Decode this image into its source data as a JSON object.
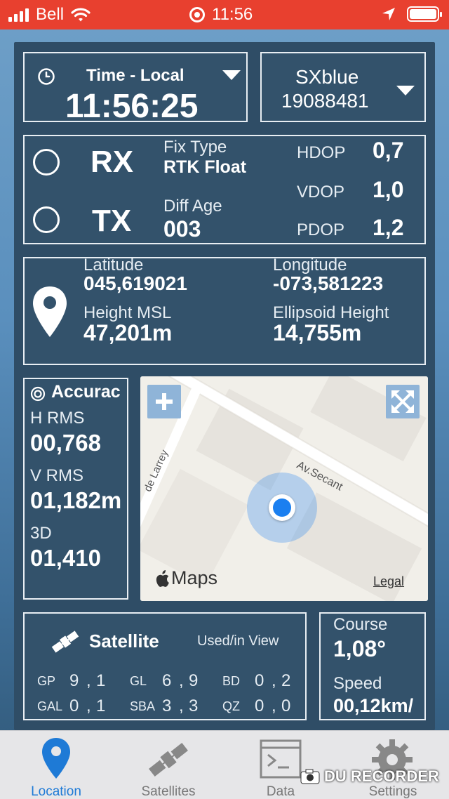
{
  "status_bar": {
    "carrier": "Bell",
    "time": "11:56"
  },
  "time_box": {
    "label": "Time - Local",
    "value": "11:56:25"
  },
  "device_box": {
    "name": "SXblue",
    "serial": "19088481"
  },
  "fix_box": {
    "rx_label": "RX",
    "tx_label": "TX",
    "fix_type_label": "Fix Type",
    "fix_type_value": "RTK Float",
    "diff_age_label": "Diff Age",
    "diff_age_value": "003",
    "hdop_label": "HDOP",
    "hdop_value": "0,7",
    "vdop_label": "VDOP",
    "vdop_value": "1,0",
    "pdop_label": "PDOP",
    "pdop_value": "1,2"
  },
  "position_box": {
    "latitude_label": "Latitude",
    "latitude_value": "045,619021",
    "longitude_label": "Longitude",
    "longitude_value": "-073,581223",
    "height_msl_label": "Height MSL",
    "height_msl_value": "47,201m",
    "ellipsoid_label": "Ellipsoid Height",
    "ellipsoid_value": "14,755m"
  },
  "accuracy_box": {
    "title": "Accurac",
    "h_rms_label": "H RMS",
    "h_rms_value": "00,768",
    "v_rms_label": "V RMS",
    "v_rms_value": "01,182m",
    "three_d_label": "3D",
    "three_d_value": "01,410"
  },
  "map": {
    "street_1": "Av.Secant",
    "street_2": "de Larrey",
    "attribution": "Maps",
    "legal": "Legal"
  },
  "satellite_box": {
    "title": "Satellite",
    "subtitle": "Used/in View",
    "rows": [
      [
        {
          "sys": "GP",
          "used": "9",
          "view": "1"
        },
        {
          "sys": "GL",
          "used": "6",
          "view": "9"
        },
        {
          "sys": "BD",
          "used": "0",
          "view": "2"
        }
      ],
      [
        {
          "sys": "GAL",
          "used": "0",
          "view": "1"
        },
        {
          "sys": "SBA",
          "used": "3",
          "view": "3"
        },
        {
          "sys": "QZ",
          "used": "0",
          "view": "0"
        }
      ]
    ]
  },
  "course_box": {
    "course_label": "Course",
    "course_value": "1,08°",
    "speed_label": "Speed",
    "speed_value": "00,12km/"
  },
  "tabs": [
    {
      "label": "Location",
      "active": true
    },
    {
      "label": "Satellites",
      "active": false
    },
    {
      "label": "Data",
      "active": false
    },
    {
      "label": "Settings",
      "active": false
    }
  ],
  "watermark": "DU RECORDER",
  "colors": {
    "status_bar": "#e8402f",
    "panel": "#2f4d66",
    "active_tab": "#1e7ad6",
    "location_dot": "#1a7ff0"
  }
}
